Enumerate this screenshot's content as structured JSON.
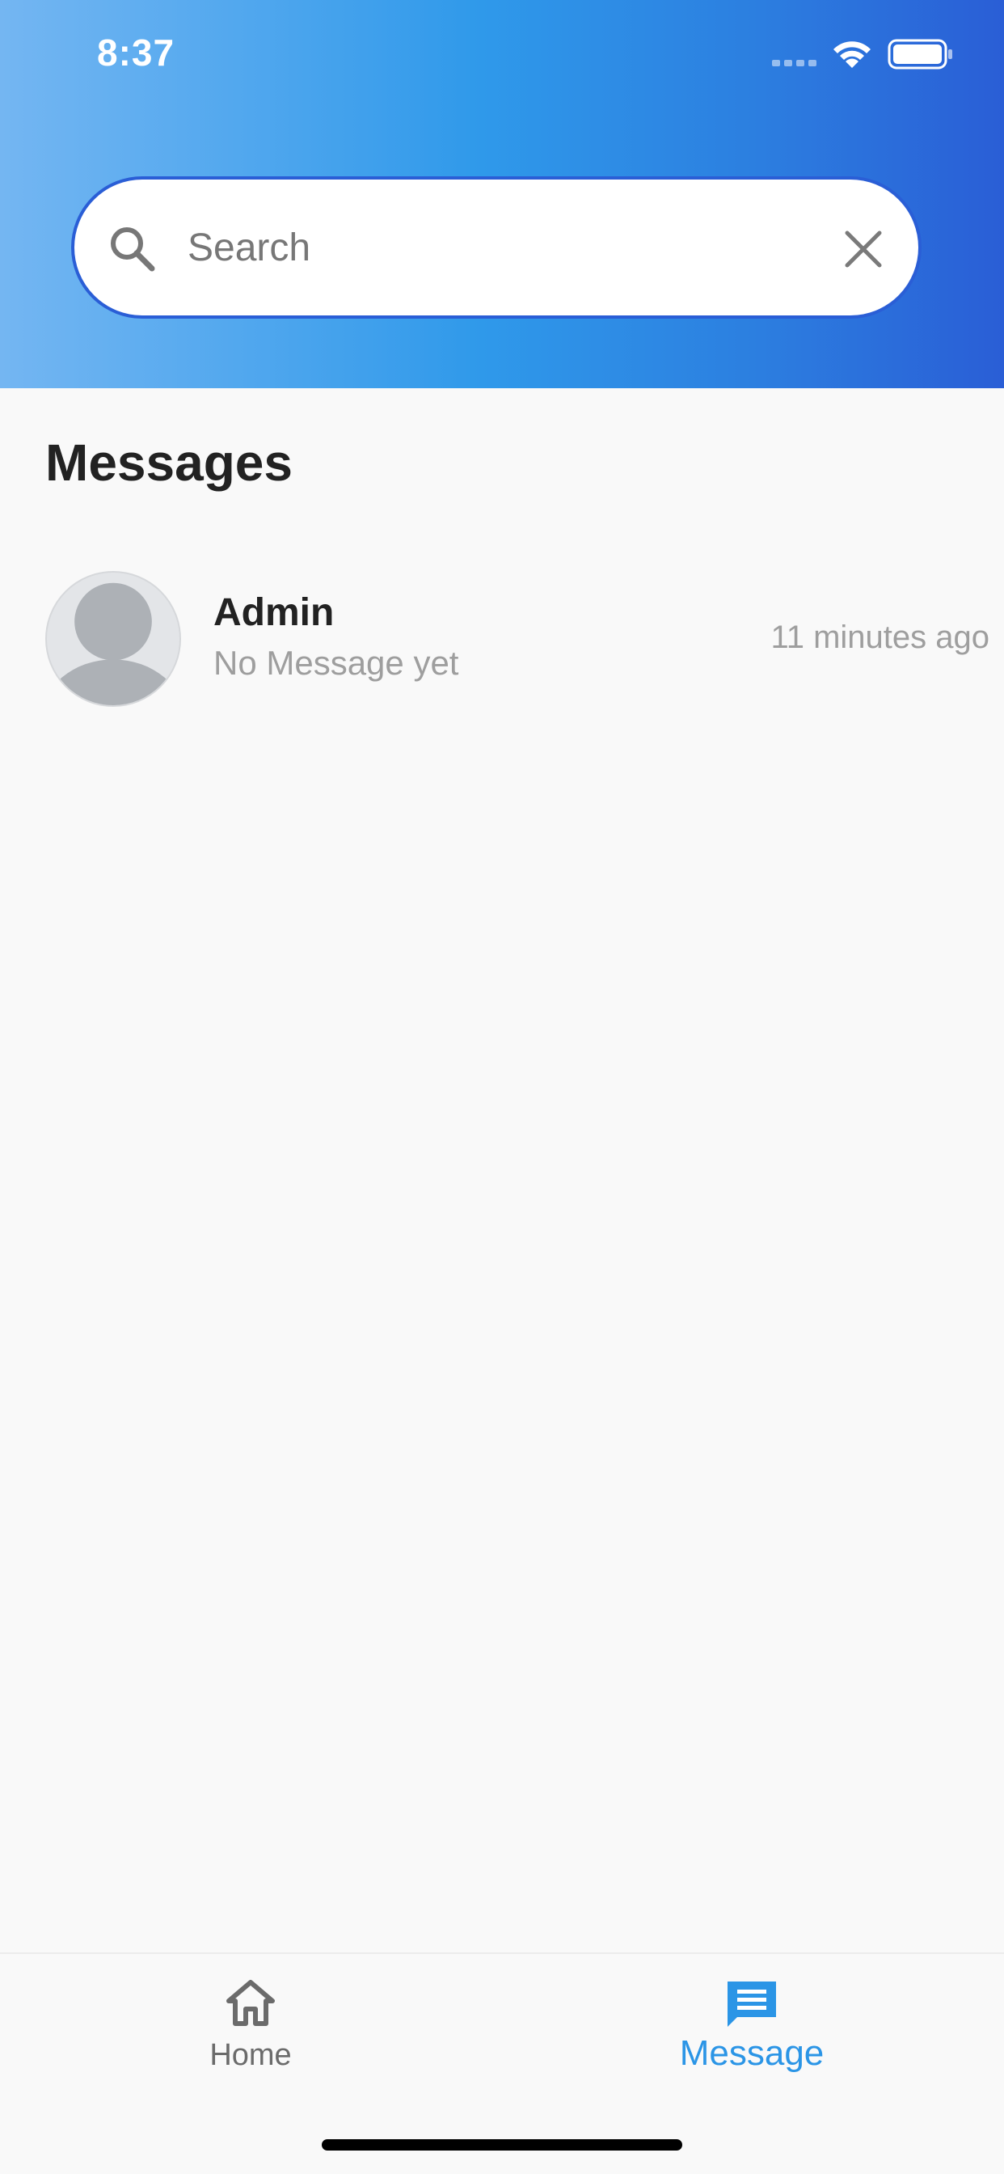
{
  "status_bar": {
    "time": "8:37",
    "icons": [
      "signal-icon",
      "wifi-icon",
      "battery-icon"
    ]
  },
  "search": {
    "placeholder": "Search",
    "value": "",
    "icon": "search-icon",
    "clear_icon": "close-icon"
  },
  "page": {
    "title": "Messages"
  },
  "conversations": [
    {
      "name": "Admin",
      "preview": "No Message yet",
      "time": "11 minutes ago",
      "avatar": "default-user-avatar"
    }
  ],
  "bottom_nav": {
    "items": [
      {
        "label": "Home",
        "icon": "home-icon",
        "active": false
      },
      {
        "label": "Message",
        "icon": "message-icon",
        "active": true
      }
    ]
  },
  "colors": {
    "accent": "#2b95e6",
    "header_gradient_start": "#74b6f2",
    "header_gradient_end": "#2a5ed6",
    "search_border": "#2a5ed6",
    "inactive_nav": "#6b6b6b"
  }
}
